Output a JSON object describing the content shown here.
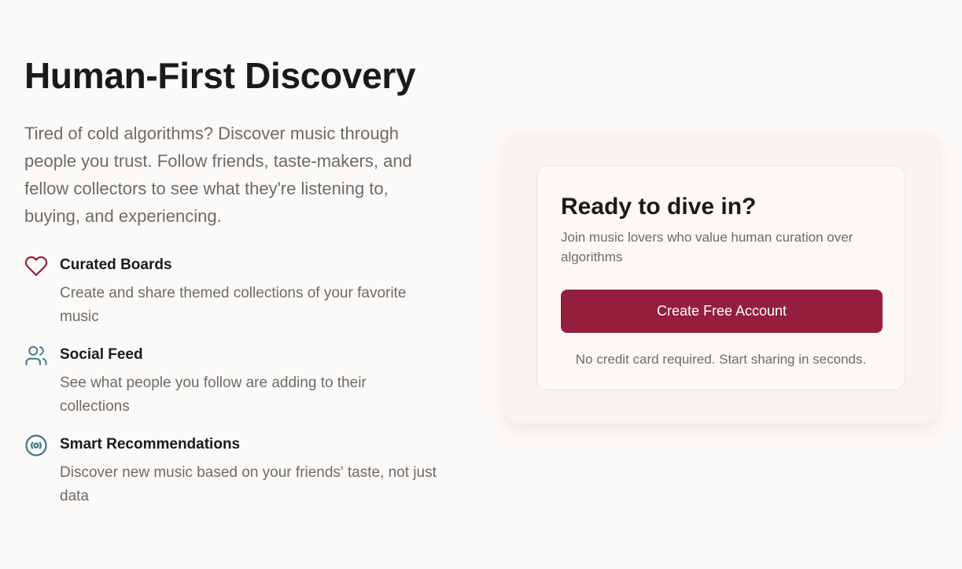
{
  "hero": {
    "title": "Human-First Discovery",
    "description": "Tired of cold algorithms? Discover music through people you trust. Follow friends, taste-makers, and fellow collectors to see what they're listening to, buying, and experiencing."
  },
  "features": [
    {
      "icon": "heart-icon",
      "title": "Curated Boards",
      "description": "Create and share themed collections of your favorite music"
    },
    {
      "icon": "users-icon",
      "title": "Social Feed",
      "description": "See what people you follow are adding to their collections"
    },
    {
      "icon": "disc-icon",
      "title": "Smart Recommendations",
      "description": "Discover new music based on your friends' taste, not just data"
    }
  ],
  "signup_card": {
    "title": "Ready to dive in?",
    "subtitle": "Join music lovers who value human curation over algorithms",
    "button_label": "Create Free Account",
    "note": "No credit card required. Start sharing in seconds."
  },
  "colors": {
    "accent": "#951e3e",
    "icon_teal": "#3e7a85",
    "background": "#fcfaf8",
    "card_background": "#f7f3ee",
    "muted_text": "#6f6a66"
  }
}
